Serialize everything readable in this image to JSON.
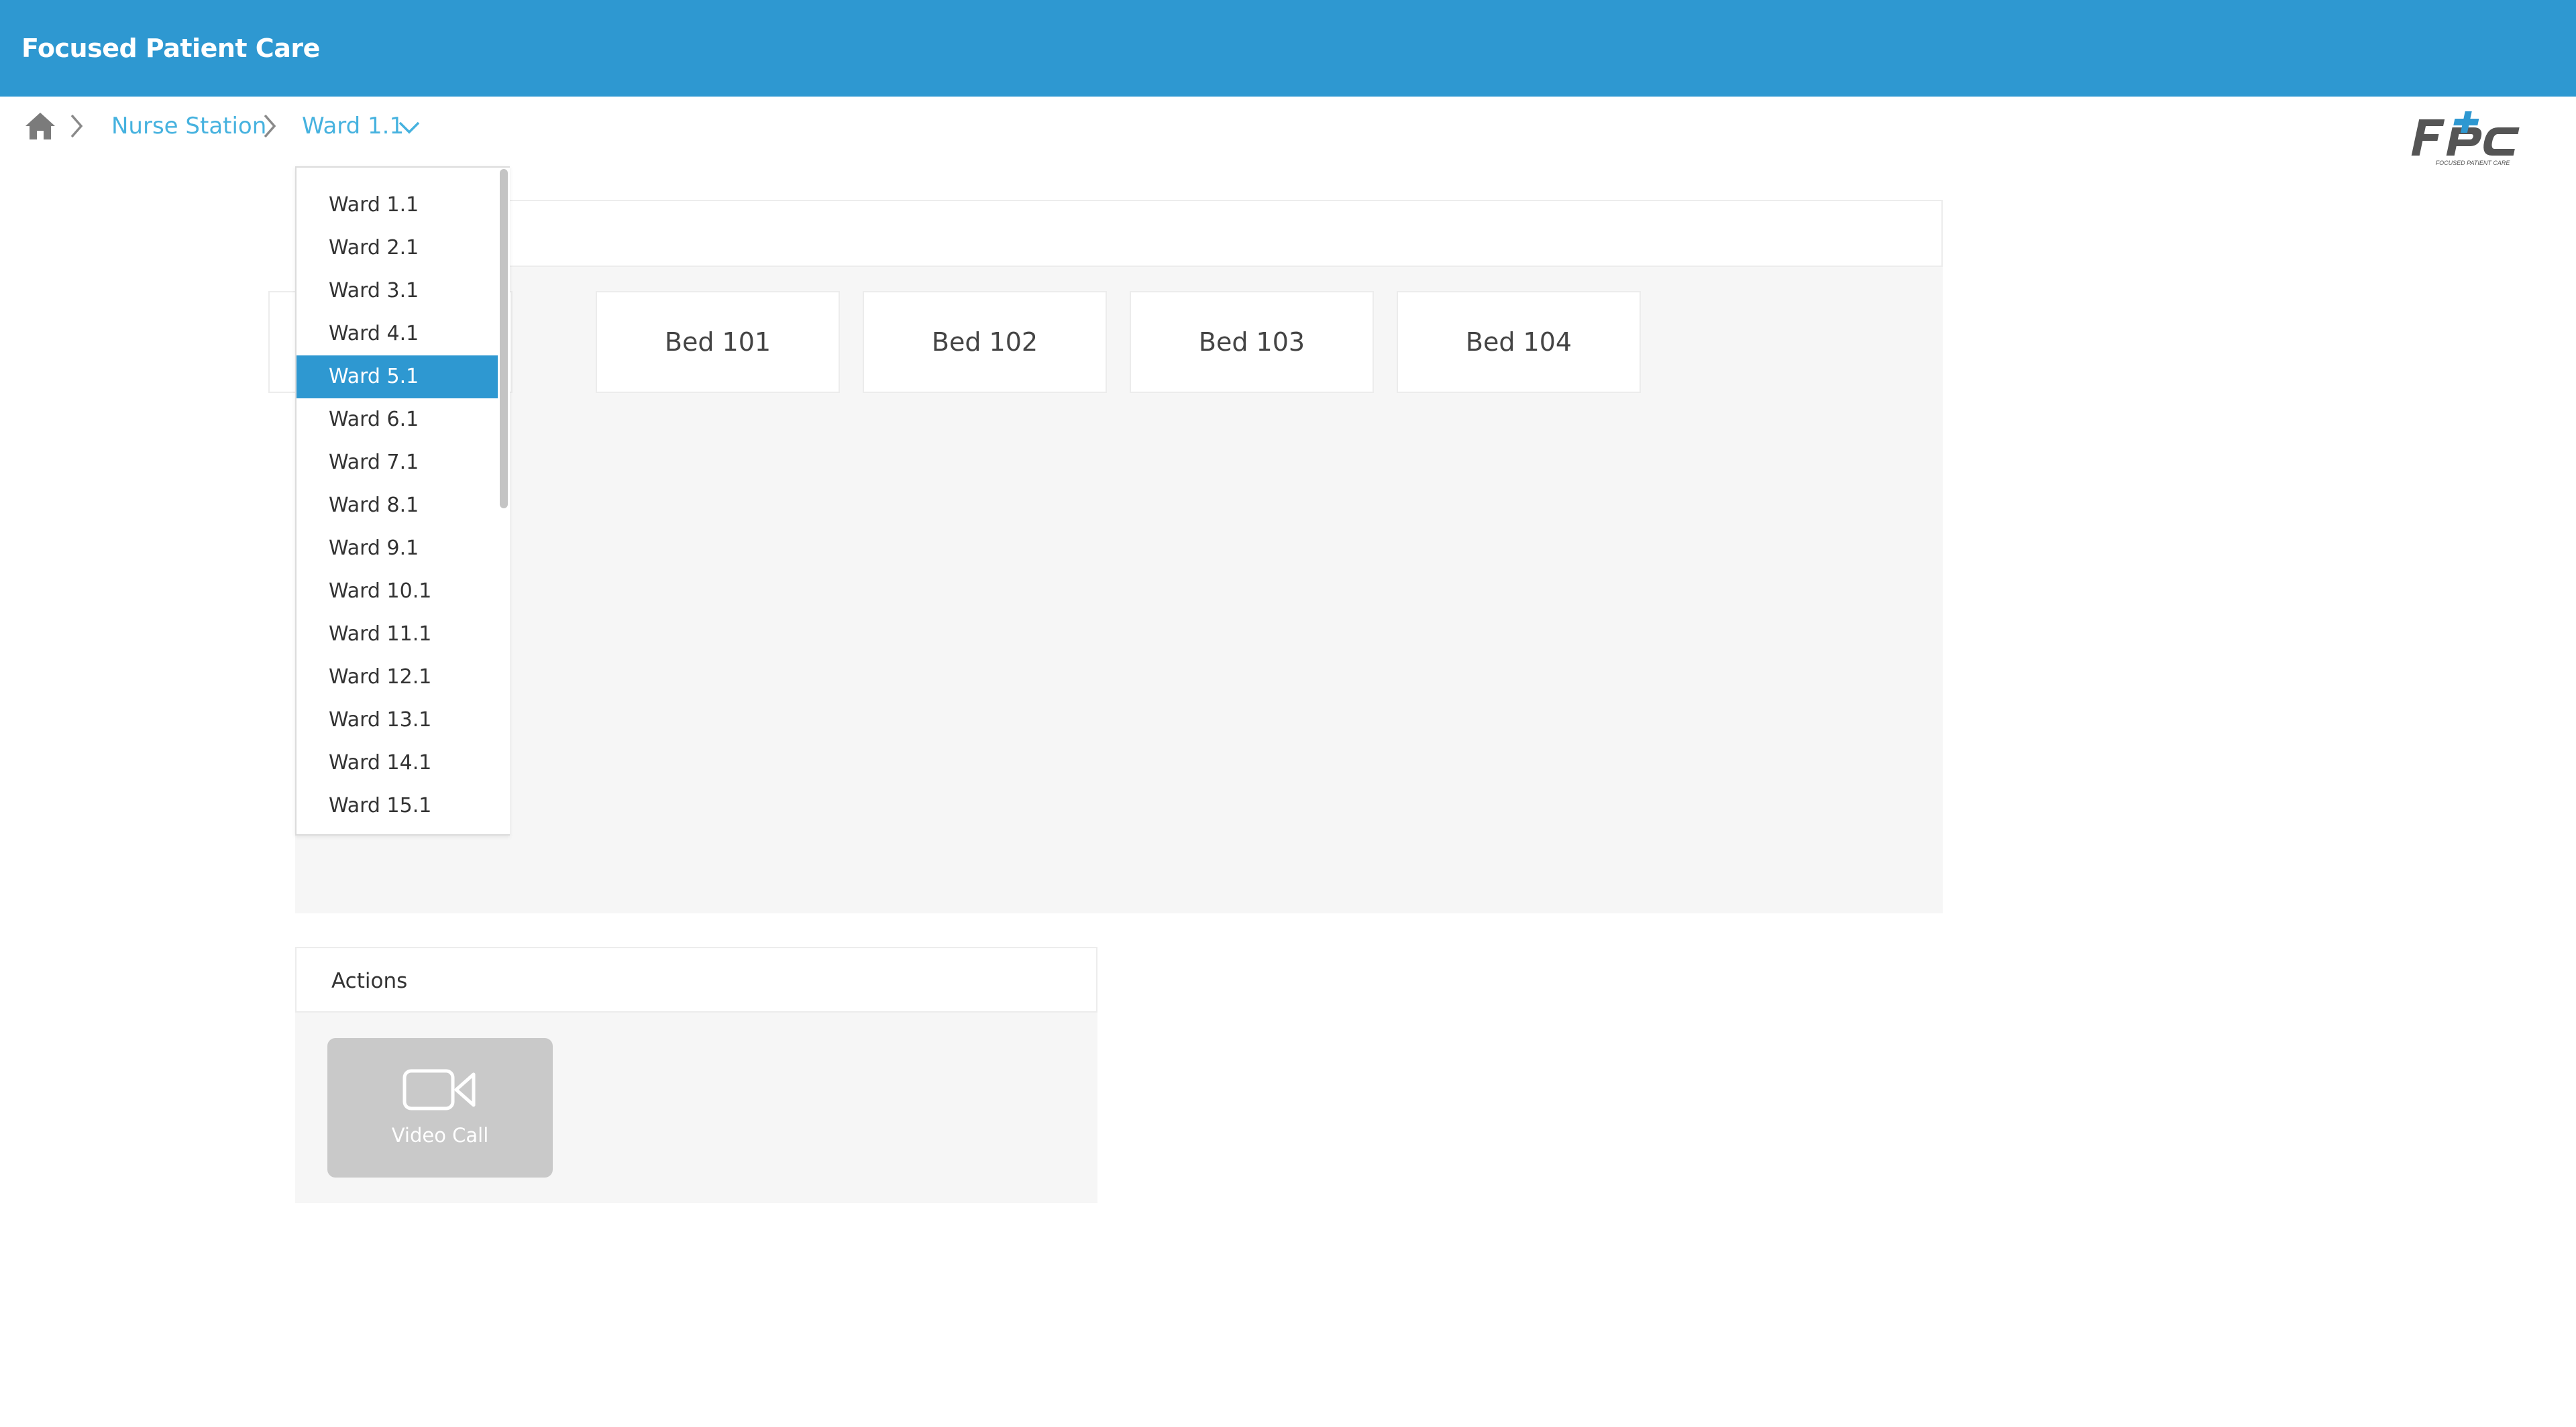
{
  "app": {
    "title": "Focused Patient Care"
  },
  "breadcrumb": {
    "home_icon": "home-icon",
    "nurse_station": "Nurse Station",
    "current_ward": "Ward 1.1"
  },
  "logo": {
    "brand": "FPC",
    "tagline": "FOCUSED PATIENT CARE"
  },
  "beds": [
    {
      "label": "Bed 101"
    },
    {
      "label": "Bed 102"
    },
    {
      "label": "Bed 103"
    },
    {
      "label": "Bed 104"
    }
  ],
  "actions": {
    "title": "Actions",
    "video_call_label": "Video Call",
    "video_call_icon": "video-camera-icon"
  },
  "ward_dropdown": {
    "selected": "Ward 5.1",
    "options": [
      "Ward 1.1",
      "Ward 2.1",
      "Ward 3.1",
      "Ward 4.1",
      "Ward 5.1",
      "Ward 6.1",
      "Ward 7.1",
      "Ward 8.1",
      "Ward 9.1",
      "Ward 10.1",
      "Ward 11.1",
      "Ward 12.1",
      "Ward 13.1",
      "Ward 14.1",
      "Ward 15.1"
    ]
  },
  "colors": {
    "header_blue": "#2e98d1",
    "link_blue": "#46b2df",
    "selected_option": "#2e98d1",
    "disabled_button": "#c9c9c9"
  }
}
